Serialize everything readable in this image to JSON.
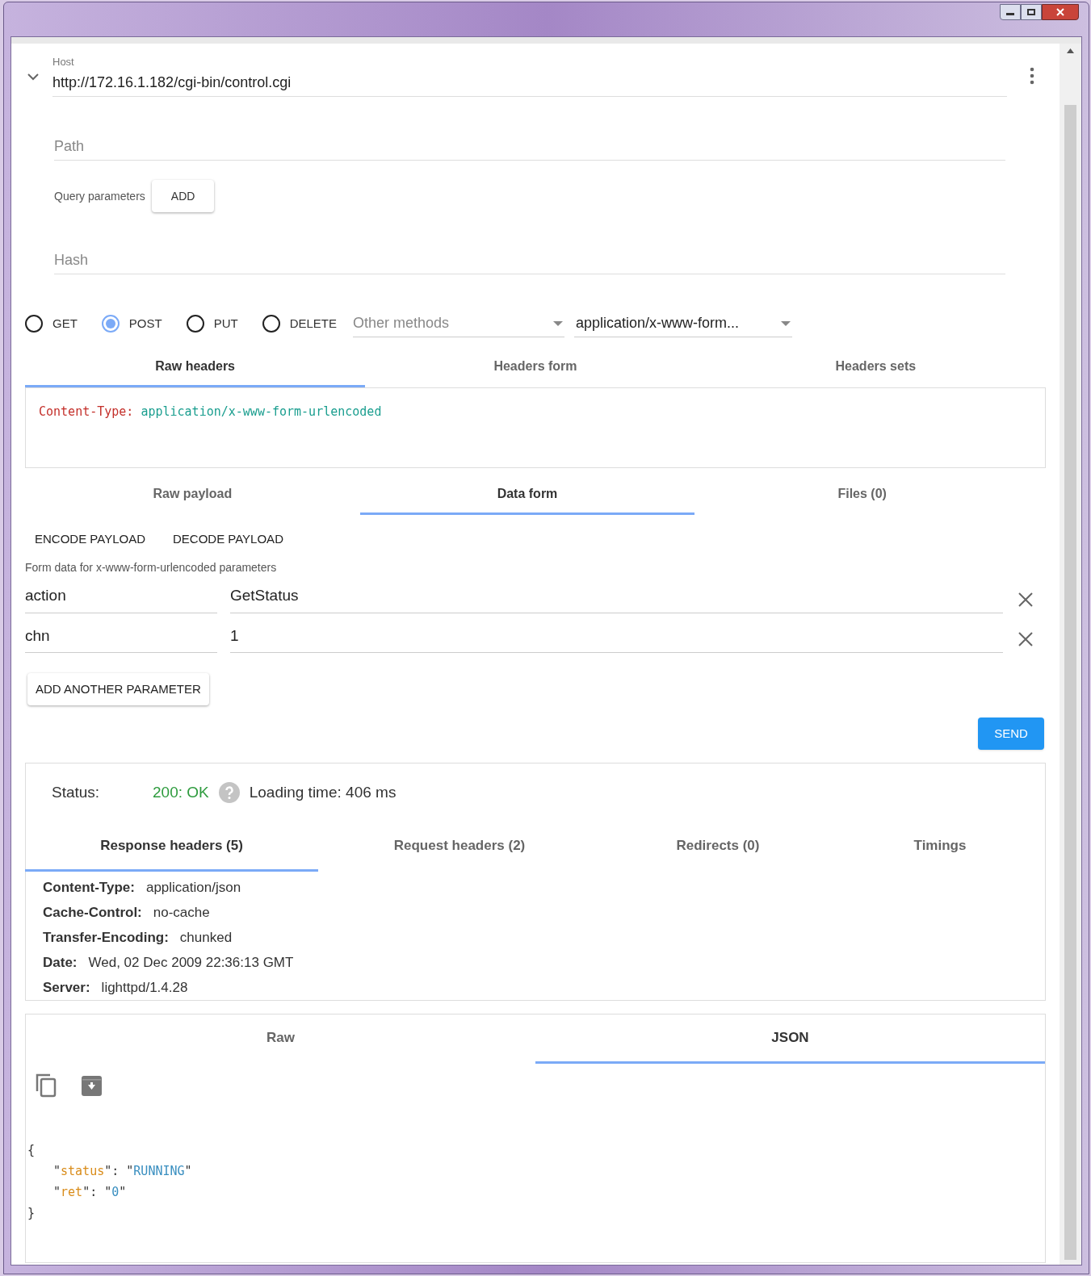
{
  "request": {
    "host_label": "Host",
    "host_value": "http://172.16.1.182/cgi-bin/control.cgi",
    "path_placeholder": "Path",
    "query_label": "Query parameters",
    "query_add": "ADD",
    "hash_placeholder": "Hash"
  },
  "methods": [
    {
      "label": "GET",
      "selected": false
    },
    {
      "label": "POST",
      "selected": true
    },
    {
      "label": "PUT",
      "selected": false
    },
    {
      "label": "DELETE",
      "selected": false
    }
  ],
  "other_methods_placeholder": "Other methods",
  "content_type_select": "application/x-www-form...",
  "header_tabs": [
    {
      "label": "Raw headers",
      "selected": true
    },
    {
      "label": "Headers form",
      "selected": false
    },
    {
      "label": "Headers sets",
      "selected": false
    }
  ],
  "raw_headers": {
    "name": "Content-Type:",
    "value": "application/x-www-form-urlencoded"
  },
  "payload_tabs": [
    {
      "label": "Raw payload",
      "selected": false
    },
    {
      "label": "Data form",
      "selected": true
    },
    {
      "label": "Files (0)",
      "selected": false
    }
  ],
  "payload_actions": [
    "ENCODE PAYLOAD",
    "DECODE PAYLOAD"
  ],
  "form_hint": "Form data for x-www-form-urlencoded parameters",
  "form_rows": [
    {
      "name": "action",
      "value": "GetStatus"
    },
    {
      "name": "chn",
      "value": "1"
    }
  ],
  "add_parameter": "ADD ANOTHER PARAMETER",
  "send": "SEND",
  "response": {
    "status_label": "Status:",
    "status_value": "200: OK",
    "loading_time": "Loading time: 406 ms",
    "tabs": [
      {
        "label": "Response headers (5)",
        "selected": true
      },
      {
        "label": "Request headers (2)",
        "selected": false
      },
      {
        "label": "Redirects (0)",
        "selected": false
      },
      {
        "label": "Timings",
        "selected": false
      }
    ],
    "headers": [
      {
        "name": "Content-Type:",
        "value": "application/json"
      },
      {
        "name": "Cache-Control:",
        "value": "no-cache"
      },
      {
        "name": "Transfer-Encoding:",
        "value": "chunked"
      },
      {
        "name": "Date:",
        "value": "Wed, 02 Dec 2009 22:36:13 GMT"
      },
      {
        "name": "Server:",
        "value": "lighttpd/1.4.28"
      }
    ]
  },
  "body": {
    "tabs": [
      {
        "label": "Raw",
        "selected": false
      },
      {
        "label": "JSON",
        "selected": true
      }
    ],
    "open": "{",
    "close": "}",
    "quote": "\"",
    "colon": ":",
    "entries": [
      {
        "key": "status",
        "value": "RUNNING"
      },
      {
        "key": "ret",
        "value": "0"
      }
    ]
  }
}
